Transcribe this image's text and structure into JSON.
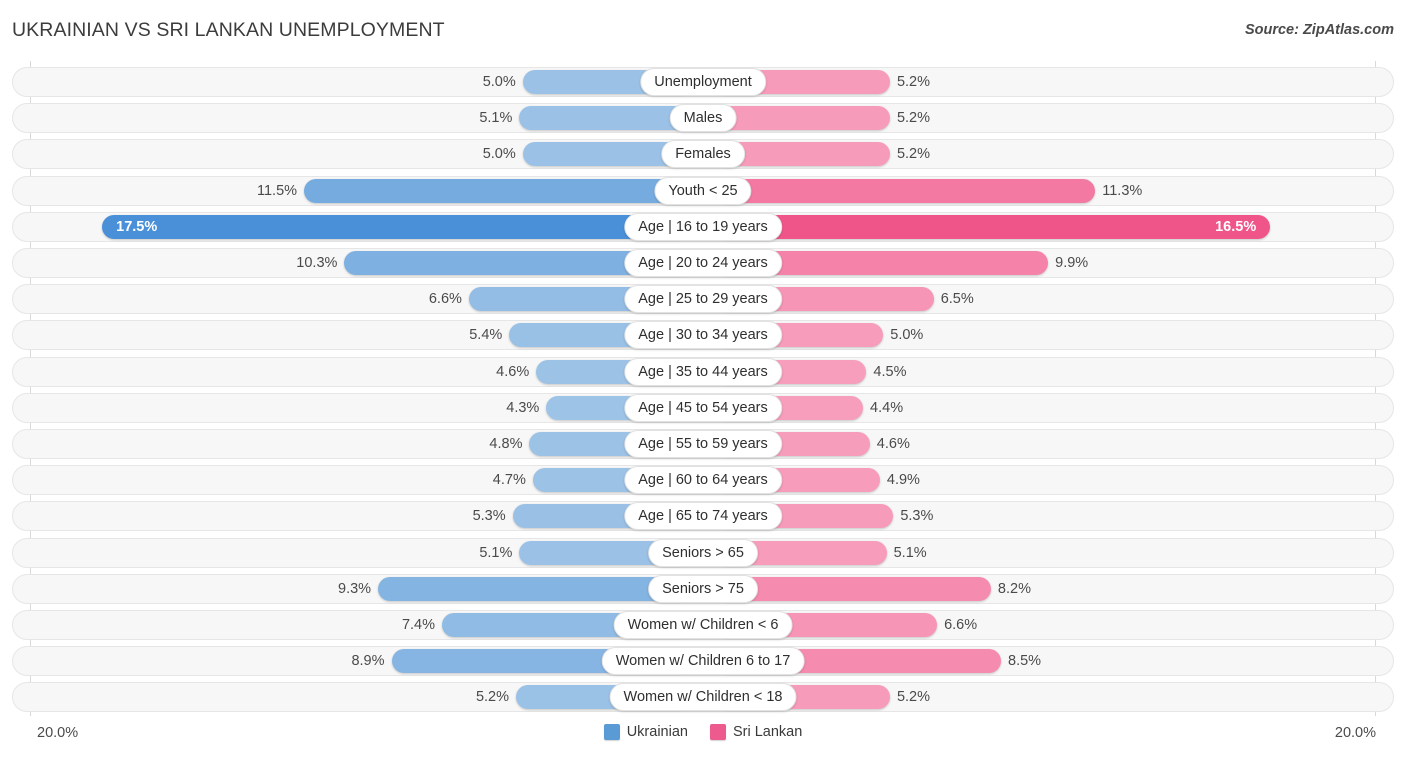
{
  "header": {
    "title": "UKRAINIAN VS SRI LANKAN UNEMPLOYMENT",
    "source": "Source: ZipAtlas.com"
  },
  "footer": {
    "axis_left": "20.0%",
    "axis_right": "20.0%",
    "legend": [
      {
        "label": "Ukrainian",
        "color": "#5b9bd5"
      },
      {
        "label": "Sri Lankan",
        "color": "#ed5a8e"
      }
    ]
  },
  "colors": {
    "left_base": "#9dc3e6",
    "left_strong": "#4a90d9",
    "right_base": "#f79ebc",
    "right_strong": "#ef4d85",
    "track": "#f7f7f7",
    "track_border": "#e6e6e6"
  },
  "chart_data": {
    "type": "bar",
    "subtype": "diverging-bar",
    "title": "UKRAINIAN VS SRI LANKAN UNEMPLOYMENT",
    "source": "Source: ZipAtlas.com",
    "xlabel": "",
    "ylabel": "",
    "xlim": [
      0,
      20.0
    ],
    "axis_max_label": "20.0%",
    "grid": false,
    "legend_position": "bottom-center",
    "categories": [
      "Unemployment",
      "Males",
      "Females",
      "Youth < 25",
      "Age | 16 to 19 years",
      "Age | 20 to 24 years",
      "Age | 25 to 29 years",
      "Age | 30 to 34 years",
      "Age | 35 to 44 years",
      "Age | 45 to 54 years",
      "Age | 55 to 59 years",
      "Age | 60 to 64 years",
      "Age | 65 to 74 years",
      "Seniors > 65",
      "Seniors > 75",
      "Women w/ Children < 6",
      "Women w/ Children 6 to 17",
      "Women w/ Children < 18"
    ],
    "series": [
      {
        "name": "Ukrainian",
        "color": "#5b9bd5",
        "side": "left",
        "values": [
          5.0,
          5.1,
          5.0,
          11.5,
          17.5,
          10.3,
          6.6,
          5.4,
          4.6,
          4.3,
          4.8,
          4.7,
          5.3,
          5.1,
          9.3,
          7.4,
          8.9,
          5.2
        ],
        "labels": [
          "5.0%",
          "5.1%",
          "5.0%",
          "11.5%",
          "17.5%",
          "10.3%",
          "6.6%",
          "5.4%",
          "4.6%",
          "4.3%",
          "4.8%",
          "4.7%",
          "5.3%",
          "5.1%",
          "9.3%",
          "7.4%",
          "8.9%",
          "5.2%"
        ]
      },
      {
        "name": "Sri Lankan",
        "color": "#ed5a8e",
        "side": "right",
        "values": [
          5.2,
          5.2,
          5.2,
          11.3,
          16.5,
          9.9,
          6.5,
          5.0,
          4.5,
          4.4,
          4.6,
          4.9,
          5.3,
          5.1,
          8.2,
          6.6,
          8.5,
          5.2
        ],
        "labels": [
          "5.2%",
          "5.2%",
          "5.2%",
          "11.3%",
          "16.5%",
          "9.9%",
          "6.5%",
          "5.0%",
          "4.5%",
          "4.4%",
          "4.6%",
          "4.9%",
          "5.3%",
          "5.1%",
          "8.2%",
          "6.6%",
          "8.5%",
          "5.2%"
        ]
      }
    ]
  },
  "rows": [
    {
      "category": "Unemployment",
      "left": "5.0%",
      "right": "5.2%"
    },
    {
      "category": "Males",
      "left": "5.1%",
      "right": "5.2%"
    },
    {
      "category": "Females",
      "left": "5.0%",
      "right": "5.2%"
    },
    {
      "category": "Youth < 25",
      "left": "11.5%",
      "right": "11.3%"
    },
    {
      "category": "Age | 16 to 19 years",
      "left": "17.5%",
      "right": "16.5%"
    },
    {
      "category": "Age | 20 to 24 years",
      "left": "10.3%",
      "right": "9.9%"
    },
    {
      "category": "Age | 25 to 29 years",
      "left": "6.6%",
      "right": "6.5%"
    },
    {
      "category": "Age | 30 to 34 years",
      "left": "5.4%",
      "right": "5.0%"
    },
    {
      "category": "Age | 35 to 44 years",
      "left": "4.6%",
      "right": "4.5%"
    },
    {
      "category": "Age | 45 to 54 years",
      "left": "4.3%",
      "right": "4.4%"
    },
    {
      "category": "Age | 55 to 59 years",
      "left": "4.8%",
      "right": "4.6%"
    },
    {
      "category": "Age | 60 to 64 years",
      "left": "4.7%",
      "right": "4.9%"
    },
    {
      "category": "Age | 65 to 74 years",
      "left": "5.3%",
      "right": "5.3%"
    },
    {
      "category": "Seniors > 65",
      "left": "5.1%",
      "right": "5.1%"
    },
    {
      "category": "Seniors > 75",
      "left": "9.3%",
      "right": "8.2%"
    },
    {
      "category": "Women w/ Children < 6",
      "left": "7.4%",
      "right": "6.6%"
    },
    {
      "category": "Women w/ Children 6 to 17",
      "left": "8.9%",
      "right": "8.5%"
    },
    {
      "category": "Women w/ Children < 18",
      "left": "5.2%",
      "right": "5.2%"
    }
  ]
}
